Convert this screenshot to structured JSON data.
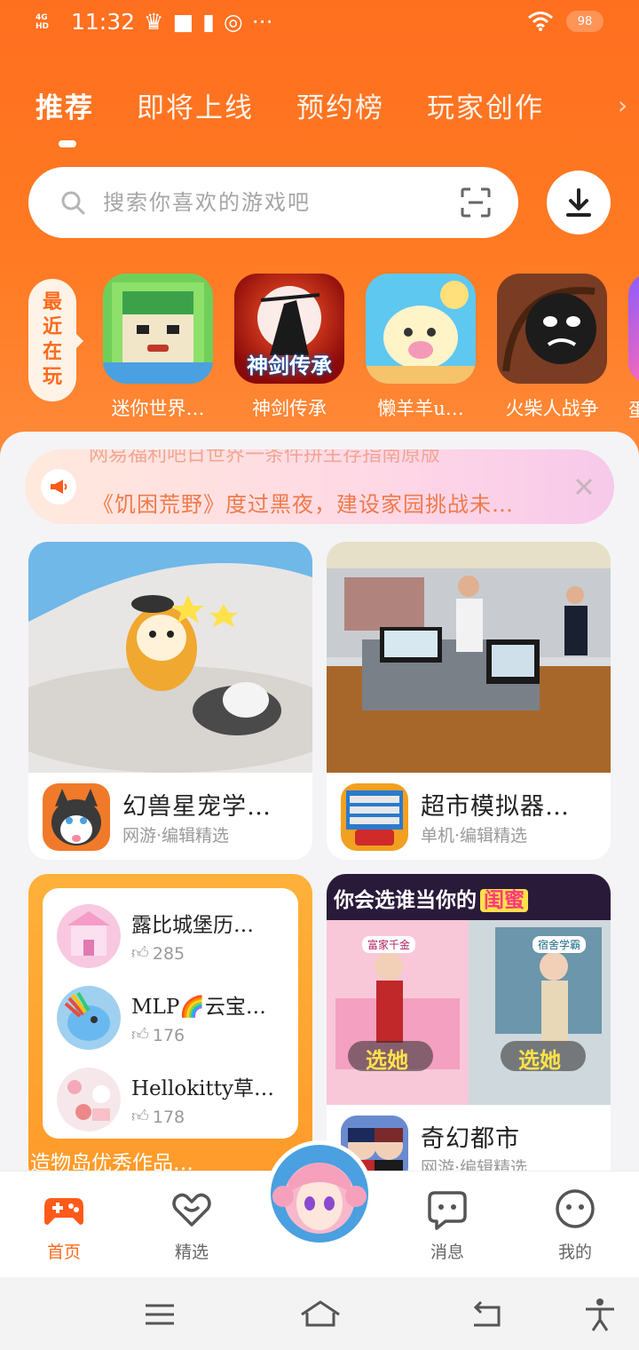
{
  "colors": {
    "brand": "#ff6f1f",
    "accent_text": "#ff6a1a",
    "notice_text": "#f07a4a"
  },
  "status_bar": {
    "network": "4G HD",
    "time": "11:32",
    "battery": "98",
    "more": "···"
  },
  "tabs": [
    {
      "label": "推荐",
      "active": true
    },
    {
      "label": "即将上线",
      "active": false
    },
    {
      "label": "预约榜",
      "active": false
    },
    {
      "label": "玩家创作",
      "active": false
    }
  ],
  "search": {
    "placeholder": "搜索你喜欢的游戏吧"
  },
  "recent": {
    "tag_chars": [
      "最",
      "近",
      "在",
      "玩"
    ],
    "items": [
      {
        "name": "迷你世界…",
        "icon": "mini-world-icon"
      },
      {
        "name": "神剑传承",
        "icon": "shenjian-icon",
        "icon_text": "神剑传承"
      },
      {
        "name": "懒羊羊u…",
        "icon": "lanyangyang-icon"
      },
      {
        "name": "火柴人战争",
        "icon": "stickman-war-icon"
      }
    ],
    "partial_name": "蛋"
  },
  "notice": {
    "ghost_text": "网易福利吧日世界一条件拼生存指南原版",
    "text": "《饥困荒野》度过黑夜，建设家园挑战未…"
  },
  "cards": [
    {
      "title": "幻兽星宠学…",
      "subtitle": "网游·编辑精选"
    },
    {
      "title": "超市模拟器…",
      "subtitle": "单机·编辑精选"
    },
    {
      "title": "奇幻都市",
      "subtitle": "网游·编辑精选",
      "banner": {
        "text_a": "你会选谁当你的",
        "text_b": "闺蜜",
        "choice": "选她",
        "tag_left": "富家千金",
        "tag_right": "宿舍学霸"
      }
    }
  ],
  "ugc": {
    "items": [
      {
        "title": "露比城堡历…",
        "likes": "285"
      },
      {
        "title": "MLP🌈云宝…",
        "likes": "176"
      },
      {
        "title": "Hellokitty草…",
        "likes": "178"
      }
    ],
    "footer": "造物岛优秀作品…"
  },
  "bottom_nav": [
    {
      "label": "首页",
      "icon": "gamepad-icon",
      "active": true
    },
    {
      "label": "精选",
      "icon": "heart-chat-icon",
      "active": false
    },
    {
      "label": "消息",
      "icon": "message-icon",
      "active": false
    },
    {
      "label": "我的",
      "icon": "profile-face-icon",
      "active": false
    }
  ]
}
